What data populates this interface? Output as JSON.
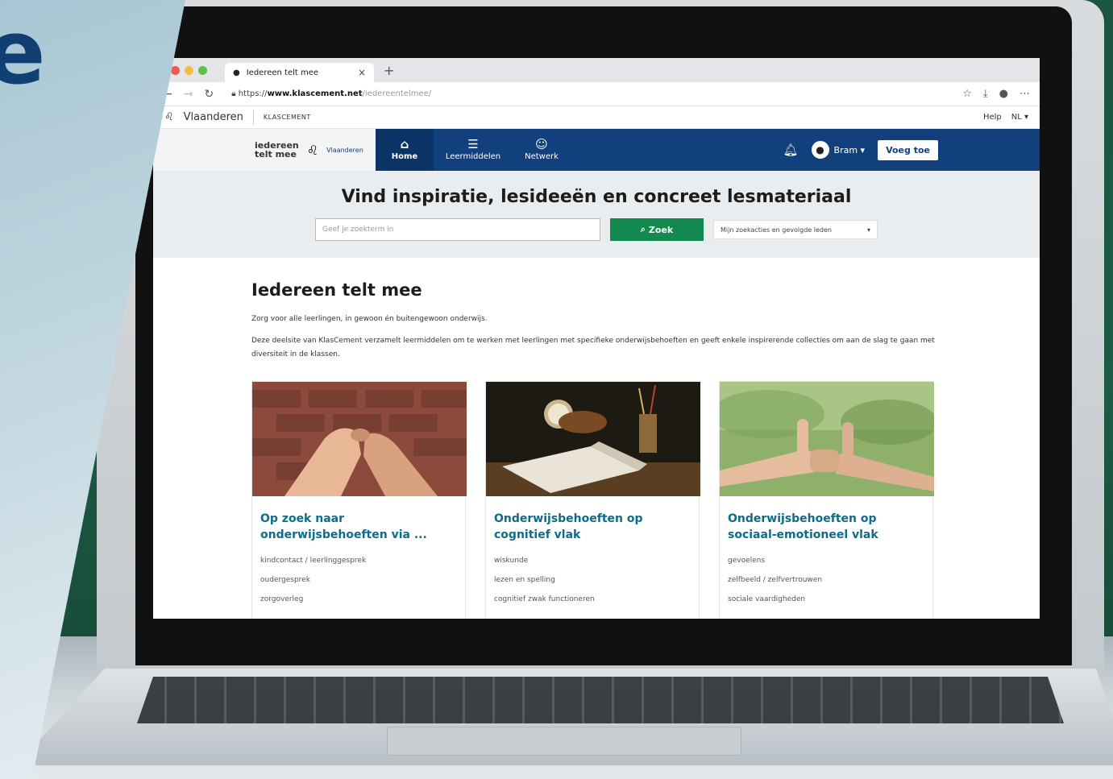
{
  "overlay": {
    "letter": "e"
  },
  "browser": {
    "tab_title": "Iedereen telt mee",
    "tab_close": "×",
    "new_tab": "+",
    "url_prefix": "https://",
    "url_domain": "www.klascement.net",
    "url_path": "/iedereentelmee/"
  },
  "vlaanderen_bar": {
    "brand": "Vlaanderen",
    "sub": "KLASCEMENT",
    "help": "Help",
    "lang": "NL ▾"
  },
  "site_nav": {
    "brand_line1": "iedereen",
    "brand_line2": "telt mee",
    "brand_vl": "Vlaanderen",
    "items": [
      {
        "label": "Home",
        "icon": "⌂"
      },
      {
        "label": "Leermiddelen",
        "icon": "☰"
      },
      {
        "label": "Netwerk",
        "icon": "☺"
      }
    ],
    "user": "Bram ▾",
    "add_label": "Voeg toe"
  },
  "hero": {
    "title": "Vind inspiratie, lesideeën en concreet lesmateriaal",
    "search_placeholder": "Geef je zoekterm in",
    "search_button": "Zoek",
    "select_value": "Mijn zoekacties en gevolgde leden"
  },
  "content": {
    "title": "Iedereen telt mee",
    "intro": "Zorg voor alle leerlingen, in gewoon én buitengewoon onderwijs.",
    "description": "Deze deelsite van KlasCement verzamelt leermiddelen om te werken met leerlingen met specifieke onderwijsbehoeften en geeft enkele inspirerende collecties om aan de slag te gaan met diversiteit in de klassen."
  },
  "cards": [
    {
      "title": "Op zoek naar onderwijsbehoeften via ...",
      "links": [
        "kindcontact / leerlinggesprek",
        "oudergesprek",
        "zorgoverleg"
      ]
    },
    {
      "title": "Onderwijsbehoeften op cognitief vlak",
      "links": [
        "wiskunde",
        "lezen en spelling",
        "cognitief zwak functioneren"
      ]
    },
    {
      "title": "Onderwijsbehoeften op sociaal-emotioneel vlak",
      "links": [
        "gevoelens",
        "zelfbeeld / zelfvertrouwen",
        "sociale vaardigheden"
      ]
    }
  ],
  "colors": {
    "nav_blue": "#12407c",
    "search_green": "#12894e",
    "card_title": "#0e6b8c"
  }
}
